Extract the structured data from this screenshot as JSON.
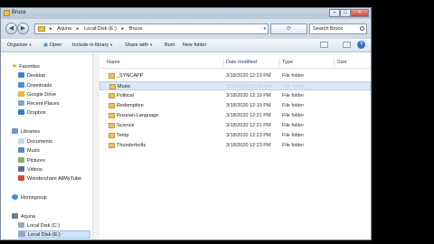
{
  "window": {
    "title": "Bruce",
    "controls": {
      "minimize": "–",
      "maximize": "□",
      "close": "×"
    }
  },
  "address": {
    "crumbs": [
      "Arjuna",
      "Local Disk (E:)",
      "Bruce"
    ],
    "separator": "►",
    "search_placeholder": "Search Bruce"
  },
  "toolbar": {
    "organize": "Organize",
    "open": "Open",
    "include_in_library": "Include in library",
    "share_with": "Share with",
    "burn": "Burn",
    "new_folder": "New folder",
    "dropdown_arrow": "▾"
  },
  "sidebar": {
    "favorites_label": "Favorites",
    "favorites": [
      "Desktop",
      "Downloads",
      "Google Drive",
      "Recent Places",
      "Dropbox"
    ],
    "libraries_label": "Libraries",
    "libraries": [
      "Documents",
      "Music",
      "Pictures",
      "Videos",
      "Wondershare AllMyTube"
    ],
    "homegroup_label": "Homegroup",
    "computer_label": "Arjuna",
    "drives": [
      "Local Disk (C:)",
      "Local Disk (E:)"
    ]
  },
  "columns": {
    "name": "Name",
    "date": "Date modified",
    "type": "Type",
    "size": "Size"
  },
  "files": [
    {
      "name": "_SYNCAPP",
      "date": "3/18/2020 12:23 PM",
      "type": "File folder"
    },
    {
      "name": "Music",
      "date": "3/18/2020 12:23 PM",
      "type": "File folder",
      "selected": true
    },
    {
      "name": "Political",
      "date": "3/18/2020 12:19 PM",
      "type": "File folder"
    },
    {
      "name": "Redemption",
      "date": "3/18/2020 12:19 PM",
      "type": "File folder"
    },
    {
      "name": "Russian-Language",
      "date": "3/18/2020 12:21 PM",
      "type": "File folder"
    },
    {
      "name": "Science",
      "date": "3/18/2020 12:21 PM",
      "type": "File folder"
    },
    {
      "name": "Temp",
      "date": "3/18/2020 12:23 PM",
      "type": "File folder"
    },
    {
      "name": "Thunderbolts",
      "date": "3/18/2020 12:23 PM",
      "type": "File folder"
    }
  ],
  "colors": {
    "folder": "#e8c45e",
    "selection": "#dbe8f6",
    "chrome": "#cdd9e6"
  }
}
